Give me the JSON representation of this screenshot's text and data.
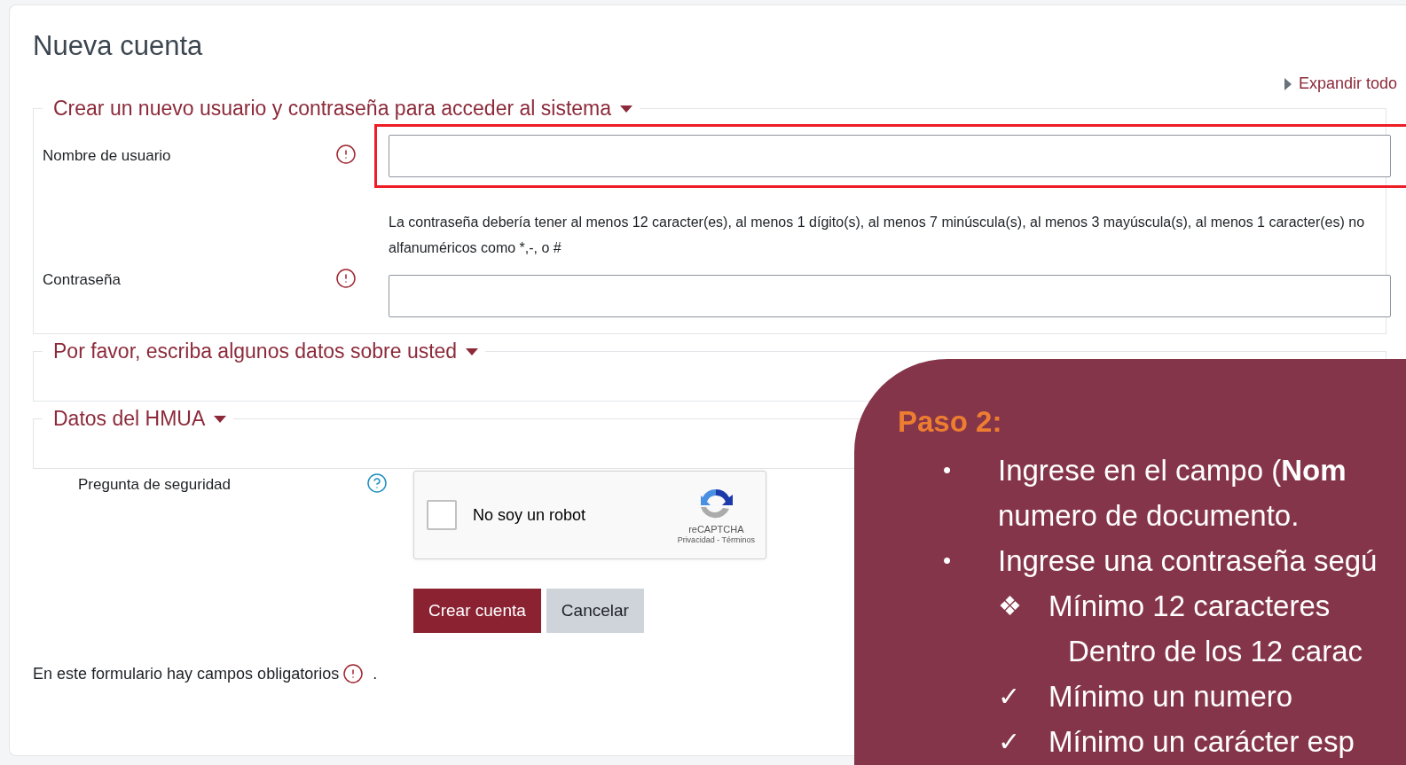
{
  "page": {
    "title": "Nueva cuenta",
    "expand_all": "Expandir todo"
  },
  "sections": [
    {
      "legend": "Crear un nuevo usuario y contraseña para acceder al sistema",
      "fields": [
        {
          "label": "Nombre de usuario",
          "highlighted": true
        },
        {
          "label": "Contraseña",
          "help": "La contraseña debería tener al menos 12 caracter(es), al menos 1 dígito(s), al menos 7 minúscula(s), al menos 3 mayúscula(s), al menos 1 caracter(es) no alfanuméricos como *,-, o #",
          "highlighted": false
        }
      ]
    },
    {
      "legend": "Por favor, escriba algunos datos sobre usted"
    },
    {
      "legend": "Datos del HMUA"
    }
  ],
  "captcha_row": {
    "label": "Pregunta de seguridad",
    "checkbox": {
      "label": "No soy un robot",
      "checked": false
    },
    "brand": "reCAPTCHA",
    "links": "Privacidad - Términos"
  },
  "buttons": [
    {
      "label": "Crear cuenta",
      "kind": "primary"
    },
    {
      "label": "Cancelar",
      "kind": "secondary"
    }
  ],
  "footer": {
    "text": "En este formulario hay campos obligatorios",
    "end": "."
  },
  "callout": {
    "heading": "Paso 2:",
    "lines": [
      {
        "kind": "bullet",
        "marker": "•",
        "text": "Ingrese en el campo (**Nom**"
      },
      {
        "kind": "continuation",
        "text": "numero de documento."
      },
      {
        "kind": "bullet",
        "marker": "•",
        "text": "Ingrese una contraseña segú"
      },
      {
        "kind": "sub",
        "marker": "❖",
        "text": "Mínimo 12 caracteres"
      },
      {
        "kind": "note",
        "text": "Dentro de los 12 carac"
      },
      {
        "kind": "sub",
        "marker": "✓",
        "text": "Mínimo un numero"
      },
      {
        "kind": "sub",
        "marker": "✓",
        "text": "Mínimo un carácter esp"
      }
    ]
  }
}
